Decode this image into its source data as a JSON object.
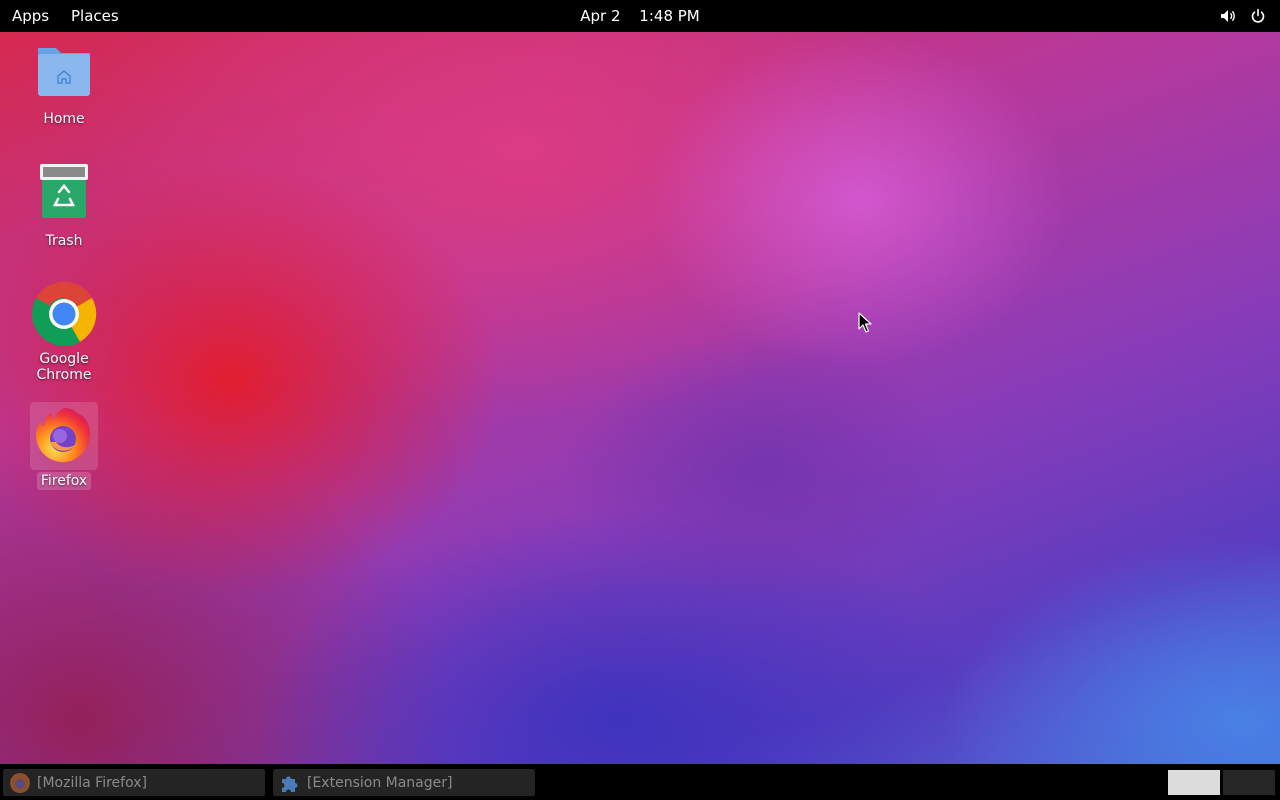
{
  "topbar": {
    "apps_label": "Apps",
    "places_label": "Places",
    "date": "Apr 2",
    "time": "1:48 PM",
    "volume_icon": "volume-icon",
    "power_icon": "power-icon"
  },
  "desktop": {
    "icons": [
      {
        "label": "Home",
        "icon": "home-folder-icon"
      },
      {
        "label": "Trash",
        "icon": "trash-icon"
      },
      {
        "label": "Google Chrome",
        "icon": "chrome-icon"
      },
      {
        "label": "Firefox",
        "icon": "firefox-icon",
        "selected": true
      }
    ]
  },
  "taskbar": {
    "tasks": [
      {
        "label": "[Mozilla Firefox]",
        "icon": "firefox-icon"
      },
      {
        "label": "[Extension Manager]",
        "icon": "puzzle-icon"
      }
    ],
    "workspaces": [
      "workspace-1",
      "workspace-2"
    ],
    "active_workspace": 1
  },
  "colors": {
    "topbar_bg": "#000000",
    "taskbar_bg": "#000000",
    "task_bg": "#242424",
    "task_text": "#8a8a8a",
    "folder_blue": "#8ab8ee",
    "trash_green": "#2aa86a"
  }
}
